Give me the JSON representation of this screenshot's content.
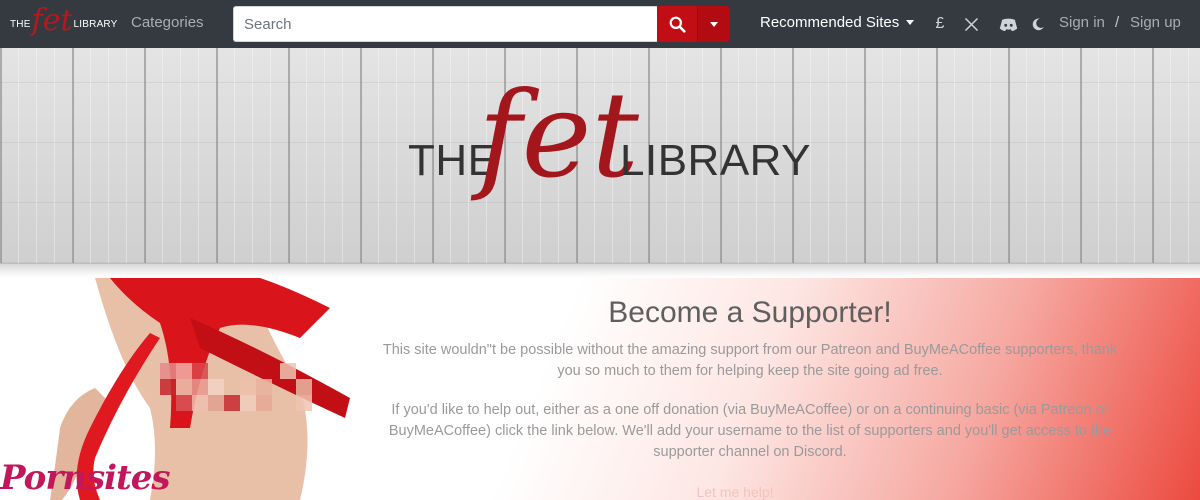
{
  "navbar": {
    "brand": {
      "the": "THE",
      "fet": "fet",
      "library": "LIBRARY"
    },
    "categories_label": "Categories",
    "search": {
      "placeholder": "Search",
      "value": ""
    },
    "recommended_label": "Recommended Sites",
    "icons": [
      "pound-icon",
      "x-icon",
      "discord-icon",
      "moon-icon"
    ],
    "pound_symbol": "£",
    "signin_label": "Sign in",
    "separator": "/",
    "signup_label": "Sign up",
    "search_button_color": "#c00e14"
  },
  "banner": {
    "logo_the": "THE",
    "logo_fet": "fet",
    "logo_library": "LIBRARY"
  },
  "supporter": {
    "title": "Become a Supporter!",
    "paragraph1": "This site wouldn\"t be possible without the amazing support from our Patreon and BuyMeACoffee supporters, thank you so much to them for helping keep the site going ad free.",
    "paragraph2": "If you'd like to help out, either as a one off donation (via BuyMeACoffee) or on a continuing basic (via Patreon or BuyMeACoffee) click the link below. We'll add your username to the list of supporters and you'll get access to the supporter channel on Discord.",
    "link_label": "Let me help!",
    "watermark": "Pornsites",
    "accent_color": "#ec4a3f"
  }
}
